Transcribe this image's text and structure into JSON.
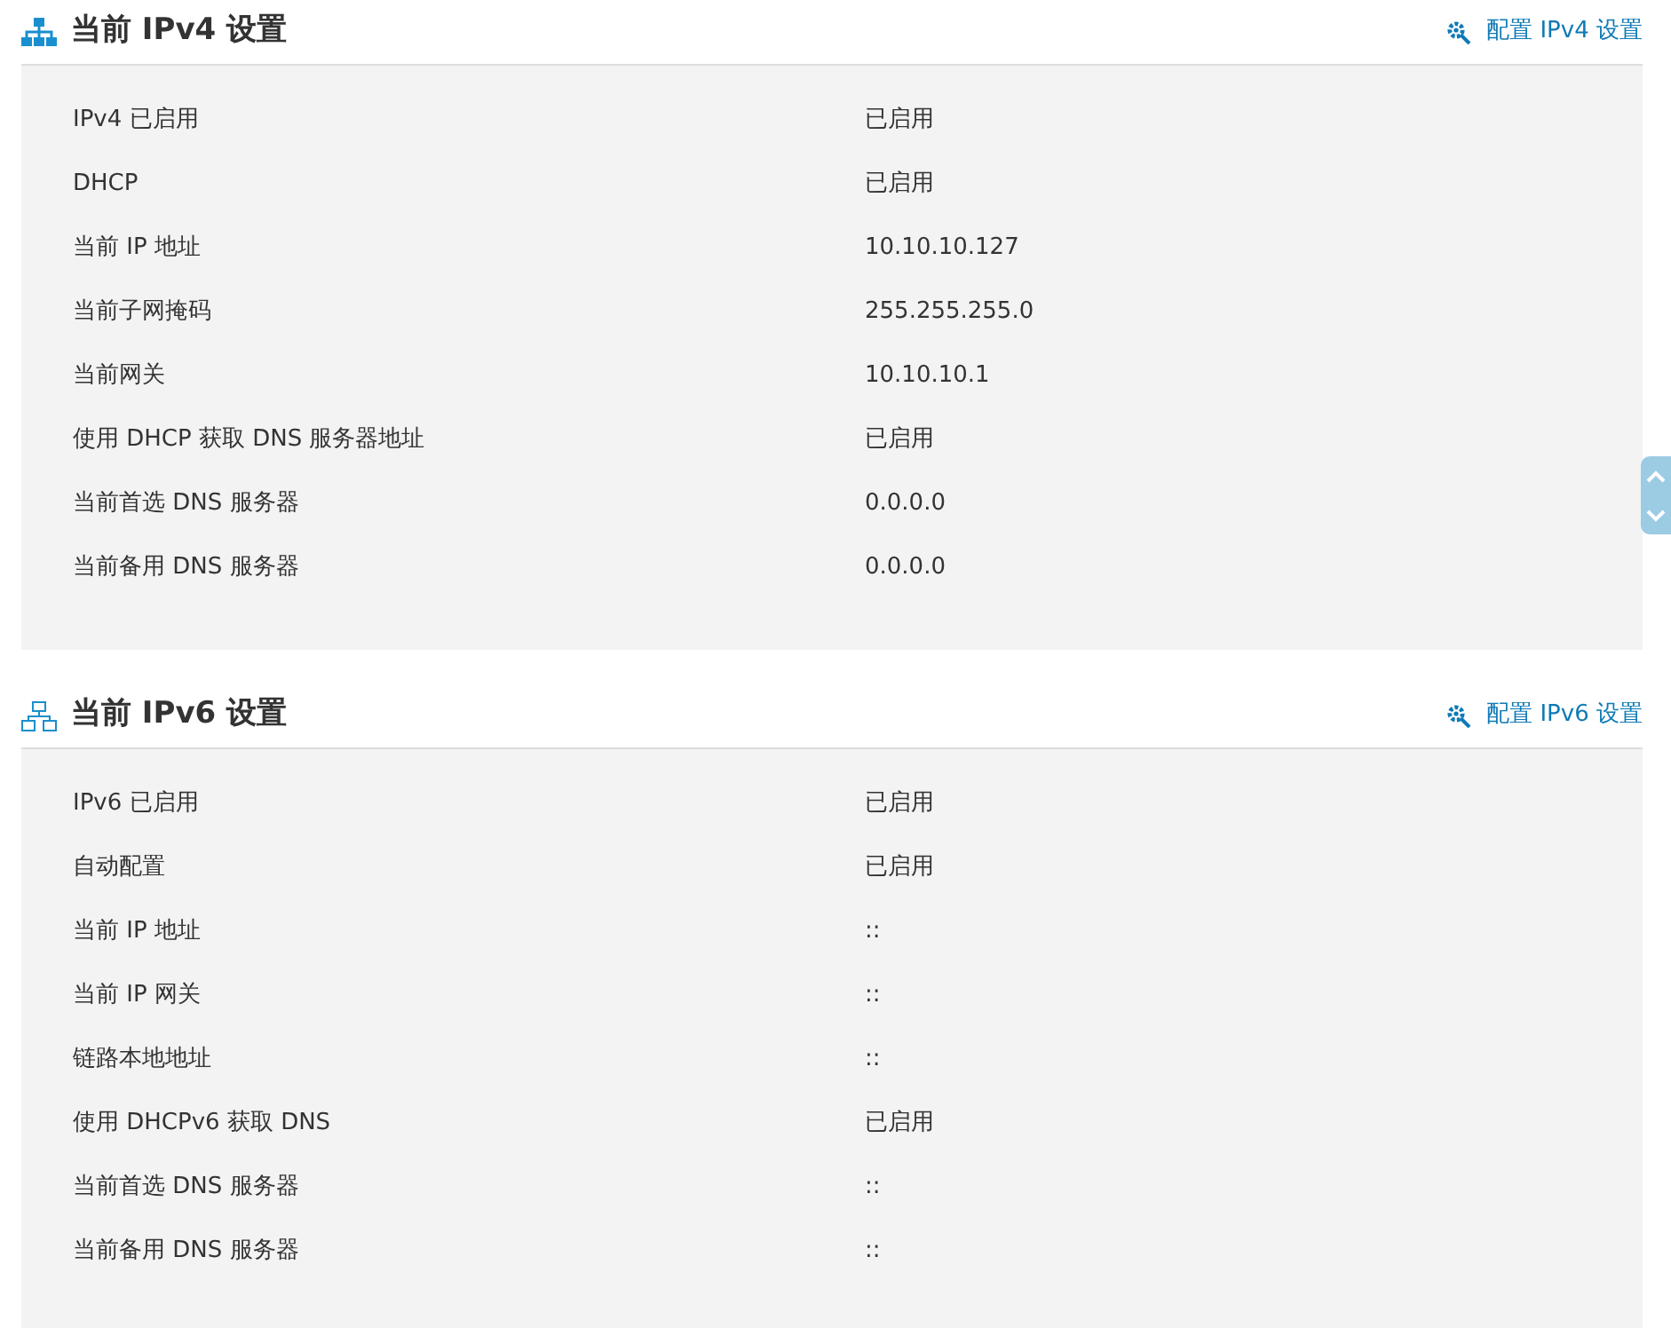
{
  "sections": [
    {
      "title": "当前 IPv4 设置",
      "kind": "filled",
      "link": "配置 IPv4 设置",
      "rows": [
        {
          "label": "IPv4 已启用",
          "value": "已启用"
        },
        {
          "label": "DHCP",
          "value": "已启用"
        },
        {
          "label": "当前 IP 地址",
          "value": "10.10.10.127"
        },
        {
          "label": "当前子网掩码",
          "value": "255.255.255.0"
        },
        {
          "label": "当前网关",
          "value": "10.10.10.1"
        },
        {
          "label": "使用 DHCP 获取 DNS 服务器地址",
          "value": "已启用"
        },
        {
          "label": "当前首选 DNS 服务器",
          "value": "0.0.0.0"
        },
        {
          "label": "当前备用 DNS 服务器",
          "value": "0.0.0.0"
        }
      ]
    },
    {
      "title": "当前 IPv6 设置",
      "kind": "outline",
      "link": "配置 IPv6 设置",
      "rows": [
        {
          "label": "IPv6 已启用",
          "value": "已启用"
        },
        {
          "label": "自动配置",
          "value": "已启用"
        },
        {
          "label": "当前 IP 地址",
          "value": "::"
        },
        {
          "label": "当前 IP 网关",
          "value": "::"
        },
        {
          "label": "链路本地地址",
          "value": "::"
        },
        {
          "label": "使用 DHCPv6 获取 DNS",
          "value": "已启用"
        },
        {
          "label": "当前首选 DNS 服务器",
          "value": "::"
        },
        {
          "label": "当前备用 DNS 服务器",
          "value": "::"
        }
      ]
    }
  ]
}
